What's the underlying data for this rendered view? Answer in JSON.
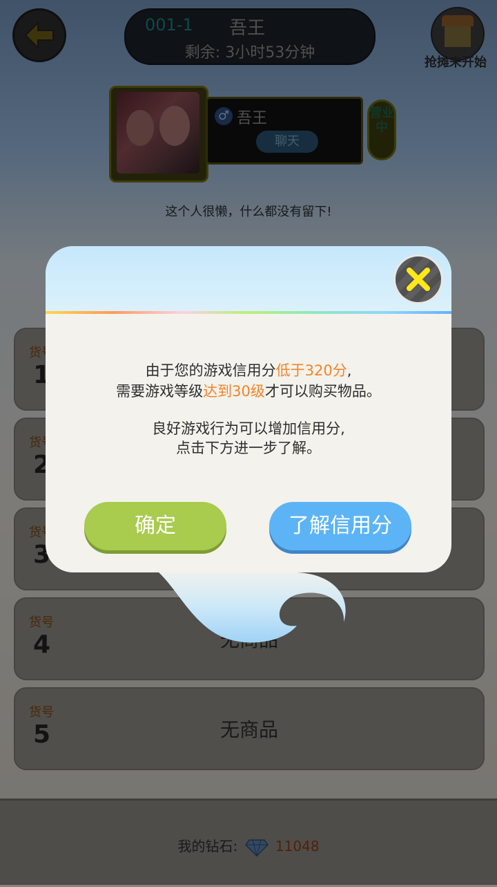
{
  "header": {
    "shop_id": "001-1",
    "shop_name": "吾王",
    "remaining": "剩余: 3小时53分钟",
    "stall_label": "抢摊未开始"
  },
  "profile": {
    "user_name": "吾王",
    "chat_label": "聊天",
    "status": "营业中",
    "signature": "这个人很懒，什么都没有留下!"
  },
  "items": [
    {
      "label": "货号",
      "number": "1",
      "empty_text": ""
    },
    {
      "label": "货号",
      "number": "2",
      "empty_text": ""
    },
    {
      "label": "货号",
      "number": "3",
      "empty_text": ""
    },
    {
      "label": "货号",
      "number": "4",
      "empty_text": "无商品"
    },
    {
      "label": "货号",
      "number": "5",
      "empty_text": "无商品"
    }
  ],
  "footer": {
    "diamond_label": "我的钻石:",
    "diamond_value": "11048"
  },
  "modal": {
    "line1_pre": "由于您的游戏信用分",
    "line1_hl": "低于320分",
    "line1_post": ",",
    "line2_pre": "需要游戏等级",
    "line2_hl": "达到30级",
    "line2_post": "才可以购买物品。",
    "line3": "良好游戏行为可以增加信用分,",
    "line4": "点击下方进一步了解。",
    "confirm_label": "确定",
    "learn_label": "了解信用分"
  },
  "colors": {
    "highlight": "#f2842a",
    "confirm_button": "#a9cb4e",
    "learn_button": "#5cb4f6",
    "close_x": "#ffe81a"
  }
}
